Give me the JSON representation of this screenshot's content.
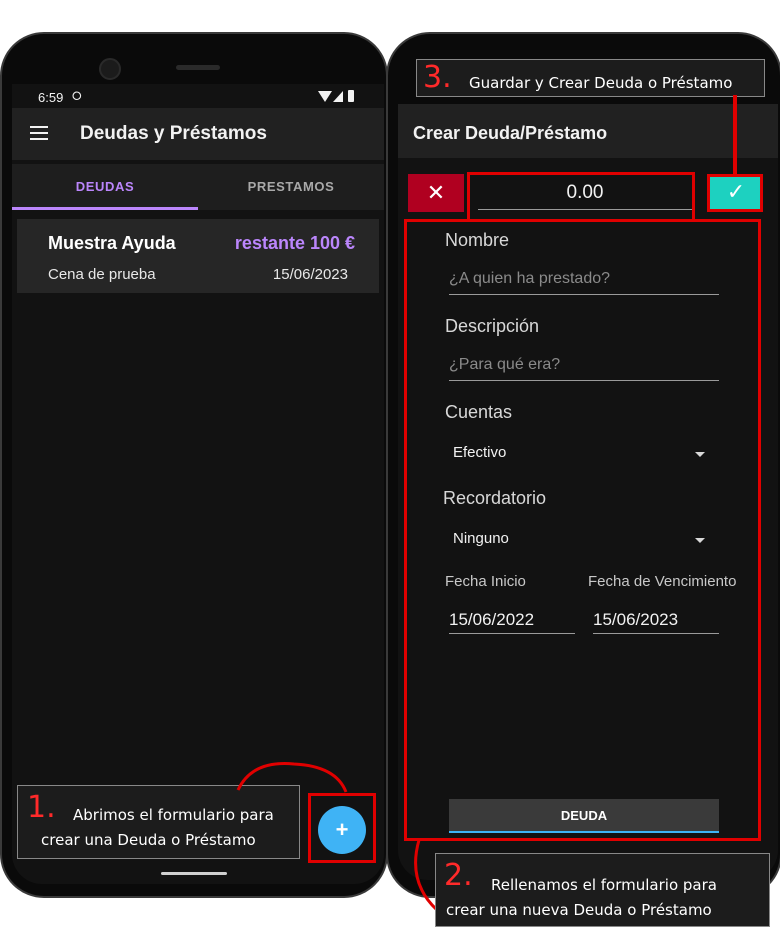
{
  "left_phone": {
    "status": {
      "time": "6:59",
      "notif_icon": "notification-icon"
    },
    "app_title": "Deudas y Préstamos",
    "tabs": [
      {
        "label": "DEUDAS",
        "active": true
      },
      {
        "label": "PRESTAMOS",
        "active": false
      }
    ],
    "entry": {
      "name": "Muestra Ayuda",
      "remaining": "restante 100 €",
      "description": "Cena de prueba",
      "date": "15/06/2023"
    },
    "fab_label": "+"
  },
  "right_phone": {
    "title": "Crear Deuda/Préstamo",
    "amount": "0.00",
    "cancel_icon": "✕",
    "confirm_icon": "✓",
    "fields": {
      "nombre_label": "Nombre",
      "nombre_placeholder": "¿A quien ha prestado?",
      "descripcion_label": "Descripción",
      "descripcion_placeholder": "¿Para qué era?",
      "cuentas_label": "Cuentas",
      "cuentas_value": "Efectivo",
      "recordatorio_label": "Recordatorio",
      "recordatorio_value": "Ninguno",
      "fecha_inicio_label": "Fecha Inicio",
      "fecha_inicio_value": "15/06/2022",
      "fecha_venc_label": "Fecha de Vencimiento",
      "fecha_venc_value": "15/06/2023"
    },
    "type_button": "DEUDA"
  },
  "annotations": {
    "step1": {
      "number": "1.",
      "text_line1": "Abrimos el formulario para",
      "text_line2": "crear una Deuda o Préstamo"
    },
    "step2": {
      "number": "2.",
      "text_line1": "Rellenamos el formulario para",
      "text_line2": "crear una nueva Deuda o Préstamo"
    },
    "step3": {
      "number": "3.",
      "text": "Guardar y Crear Deuda o Préstamo"
    }
  },
  "colors": {
    "accent": "#bb86fc",
    "fab": "#3fb3f5",
    "annotation_red": "#e00000",
    "cancel": "#b00020",
    "confirm": "#03dac5"
  }
}
